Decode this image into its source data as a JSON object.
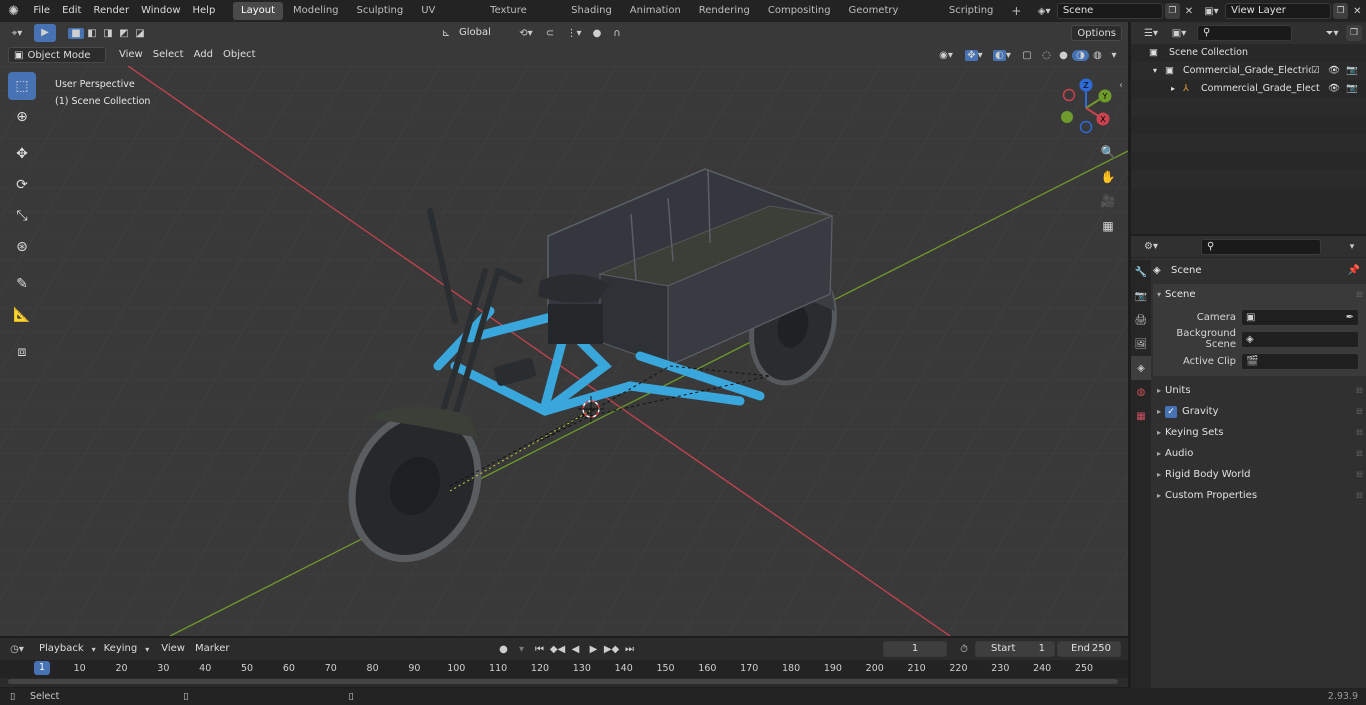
{
  "menu": {
    "file": "File",
    "edit": "Edit",
    "render": "Render",
    "window": "Window",
    "help": "Help"
  },
  "workspaces": [
    {
      "label": "Layout",
      "active": true
    },
    {
      "label": "Modeling"
    },
    {
      "label": "Sculpting"
    },
    {
      "label": "UV Editing"
    },
    {
      "label": "Texture Paint"
    },
    {
      "label": "Shading"
    },
    {
      "label": "Animation"
    },
    {
      "label": "Rendering"
    },
    {
      "label": "Compositing"
    },
    {
      "label": "Geometry Nodes"
    },
    {
      "label": "Scripting"
    }
  ],
  "add_workspace": "+",
  "scene_name": "Scene",
  "view_layer": "View Layer",
  "viewport": {
    "mode": "Object Mode",
    "view": "View",
    "select": "Select",
    "add": "Add",
    "object": "Object",
    "transform_orientation": "Global",
    "options": "Options",
    "info_line1": "User Perspective",
    "info_line2": "(1) Scene Collection",
    "gizmo": {
      "z": "Z",
      "y": "Y",
      "x": "X"
    }
  },
  "outliner": {
    "root": "Scene Collection",
    "collection": "Commercial_Grade_Electric_T",
    "object": "Commercial_Grade_Elect"
  },
  "properties": {
    "context": "Scene",
    "panel": "Scene",
    "camera_label": "Camera",
    "background_label": "Background Scene",
    "clip_label": "Active Clip",
    "subpanels": [
      "Units",
      "Gravity",
      "Keying Sets",
      "Audio",
      "Rigid Body World",
      "Custom Properties"
    ],
    "gravity_checked": true
  },
  "timeline": {
    "playback": "Playback",
    "keying": "Keying",
    "view": "View",
    "marker": "Marker",
    "current_frame": "1",
    "start_label": "Start",
    "start_value": "1",
    "end_label": "End",
    "end_value": "250",
    "ticks": [
      "1",
      "10",
      "20",
      "30",
      "40",
      "50",
      "60",
      "70",
      "80",
      "90",
      "100",
      "110",
      "120",
      "130",
      "140",
      "150",
      "160",
      "170",
      "180",
      "190",
      "200",
      "210",
      "220",
      "230",
      "240",
      "250"
    ]
  },
  "status": {
    "select": "Select",
    "version": "2.93.9"
  },
  "colors": {
    "accent": "#4772b3",
    "frame_body": "#3aa7dc",
    "axis_x": "#c8434f",
    "axis_y": "#6f9a2c"
  }
}
